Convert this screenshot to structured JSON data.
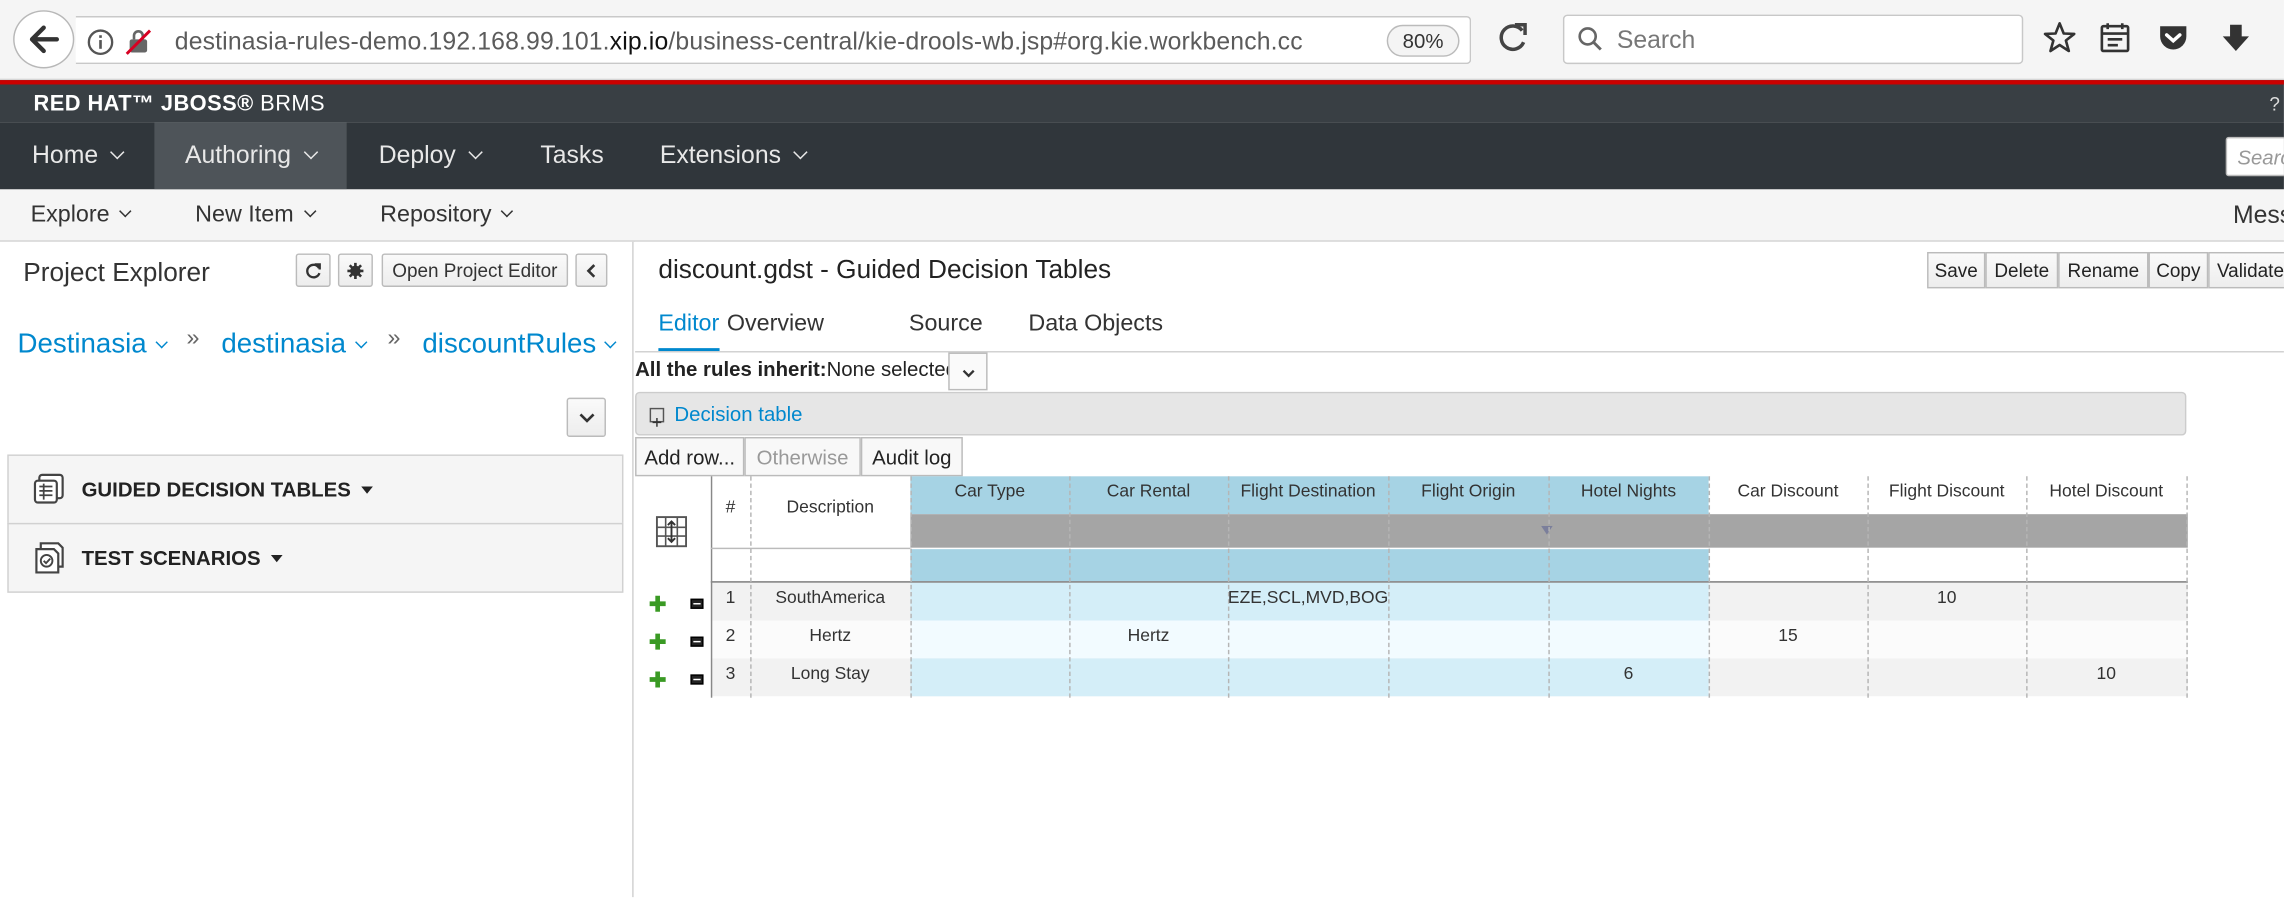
{
  "browser": {
    "url_prefix": "destinasia-rules-demo.192.168.99.101.",
    "url_domain": "xip.io",
    "url_suffix": "/business-central/kie-drools-wb.jsp#org.kie.workbench.cc",
    "zoom": "80%",
    "search_placeholder": "Search"
  },
  "brand": {
    "name_a": "RED HAT",
    "name_b": "JBOSS",
    "name_c": "BRMS",
    "help": "?"
  },
  "main_nav": {
    "items": [
      "Home",
      "Authoring",
      "Deploy",
      "Tasks",
      "Extensions"
    ],
    "search_placeholder": "Search"
  },
  "sub_nav": {
    "items": [
      "Explore",
      "New Item",
      "Repository"
    ],
    "messages": "Mess"
  },
  "project_explorer": {
    "title": "Project Explorer",
    "open_editor": "Open Project Editor",
    "breadcrumbs": [
      "Destinasia",
      "destinasia",
      "discountRules"
    ],
    "sections": [
      "GUIDED DECISION TABLES",
      "TEST SCENARIOS"
    ]
  },
  "editor": {
    "title": "discount.gdst - Guided Decision Tables",
    "actions": [
      "Save",
      "Delete",
      "Rename",
      "Copy",
      "Validate"
    ],
    "tabs": [
      "Editor",
      "Overview",
      "Source",
      "Data Objects"
    ],
    "inherit_label": "All the rules inherit:",
    "inherit_value": "None selected",
    "decision_table_label": "Decision table",
    "grid_buttons": [
      "Add row...",
      "Otherwise",
      "Audit log"
    ]
  },
  "table": {
    "num_header": "#",
    "desc_header": "Description",
    "columns": [
      "Car Type",
      "Car Rental",
      "Flight Destination",
      "Flight Origin",
      "Hotel Nights",
      "Car Discount",
      "Flight Discount",
      "Hotel Discount"
    ],
    "rows": [
      {
        "num": "1",
        "desc": "SouthAmerica",
        "cells": [
          "",
          "",
          "EZE,SCL,MVD,BOG,G",
          "",
          "",
          "",
          "10",
          ""
        ]
      },
      {
        "num": "2",
        "desc": "Hertz",
        "cells": [
          "",
          "Hertz",
          "",
          "",
          "",
          "15",
          "",
          ""
        ]
      },
      {
        "num": "3",
        "desc": "Long Stay",
        "cells": [
          "",
          "",
          "",
          "",
          "6",
          "",
          "",
          "10"
        ]
      }
    ]
  },
  "colors": {
    "condition_header": "#a6d3e4",
    "condition_cell": "#d4eef8",
    "accent": "#0088ce",
    "nav_bg": "#30363b"
  }
}
